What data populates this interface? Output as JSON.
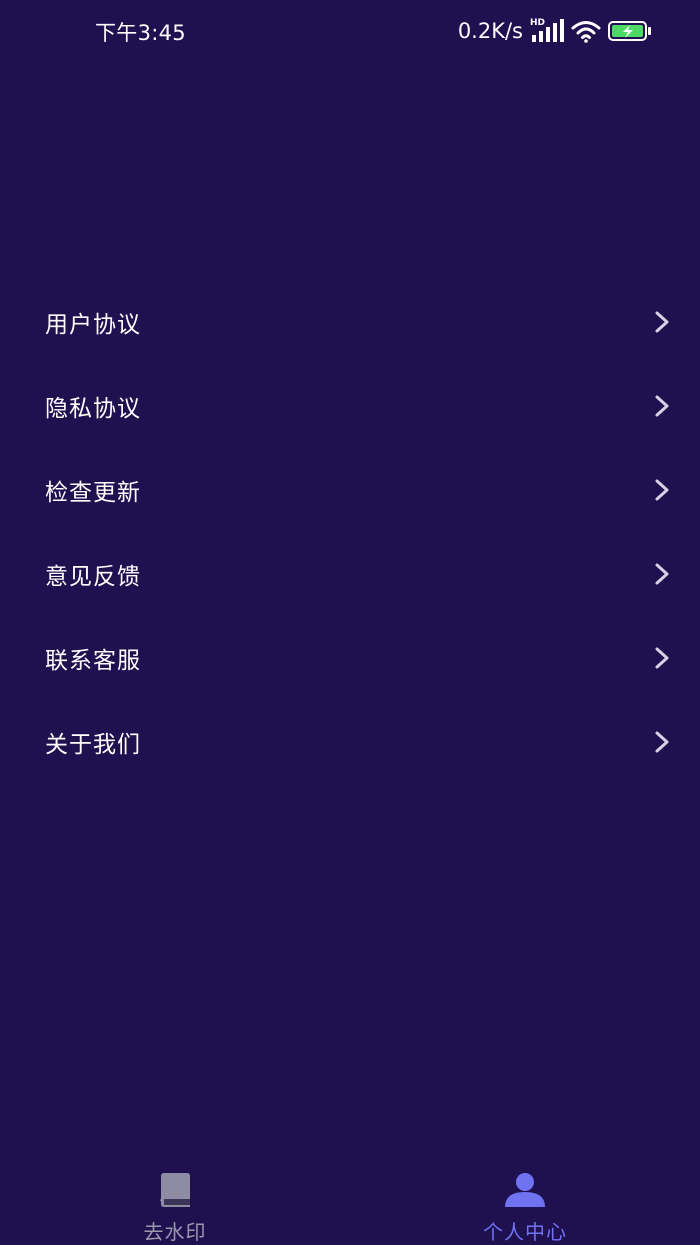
{
  "status_bar": {
    "time": "下午3:45",
    "net_speed": "0.2K/s",
    "network_badge": "HD",
    "battery_color": "#4cd964"
  },
  "menu": {
    "items": [
      {
        "label": "用户协议"
      },
      {
        "label": "隐私协议"
      },
      {
        "label": "检查更新"
      },
      {
        "label": "意见反馈"
      },
      {
        "label": "联系客服"
      },
      {
        "label": "关于我们"
      }
    ]
  },
  "tab_bar": {
    "tabs": [
      {
        "label": "去水印",
        "icon": "book-icon",
        "active": false
      },
      {
        "label": "个人中心",
        "icon": "person-icon",
        "active": true
      }
    ],
    "active_color": "#6f73f2",
    "inactive_color": "#9a98ad"
  },
  "theme": {
    "background": "#1f1150"
  }
}
